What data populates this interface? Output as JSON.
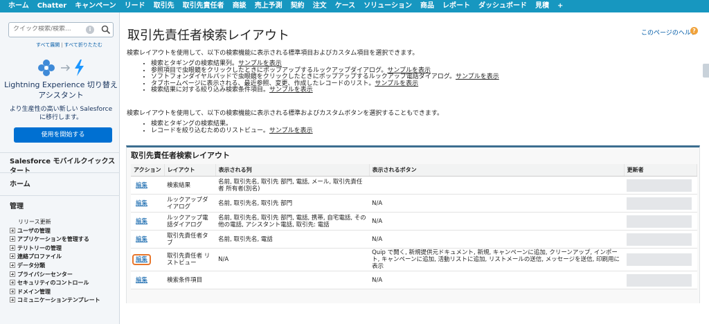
{
  "tabs": [
    "ホーム",
    "Chatter",
    "キャンペーン",
    "リード",
    "取引先",
    "取引先責任者",
    "商談",
    "売上予測",
    "契約",
    "注文",
    "ケース",
    "ソリューション",
    "商品",
    "レポート",
    "ダッシュボード",
    "見積",
    "+"
  ],
  "sidebar": {
    "search_placeholder": "クイック検索/検索...",
    "expand_all": "すべて展開",
    "collapse_all": "すべて折りたたむ",
    "lex_title": "Lightning Experience 切り替えアシスタント",
    "lex_sub": "より生産性の高い新しい Salesforce に移行します。",
    "lex_button": "使用を開始する",
    "mobile_quickstart": "Salesforce モバイルクイックスタート",
    "home": "ホーム",
    "admin": "管理",
    "items": [
      {
        "label": "リリース更新",
        "plus": false
      },
      {
        "label": "ユーザの管理",
        "plus": true
      },
      {
        "label": "アプリケーションを管理する",
        "plus": true
      },
      {
        "label": "テリトリーの管理",
        "plus": true
      },
      {
        "label": "連絡プロファイル",
        "plus": true
      },
      {
        "label": "データ分類",
        "plus": true
      },
      {
        "label": "プライバシーセンター",
        "plus": true
      },
      {
        "label": "セキュリティのコントロール",
        "plus": true
      },
      {
        "label": "ドメイン管理",
        "plus": true
      },
      {
        "label": "コミュニケーションテンプレート",
        "plus": true
      }
    ]
  },
  "main": {
    "title": "取引先責任者検索レイアウト",
    "help_link": "このページのヘルプ",
    "intro1": "検索レイアウトを使用して、以下の検索機能に表示される標準項目およびカスタム項目を選択できます。",
    "bullets1": [
      {
        "text": "検索とタギングの検索結果列。",
        "link": "サンプルを表示"
      },
      {
        "text": "参照項目で虫眼鏡をクリックしたときにポップアップするルックアップダイアログ。",
        "link": "サンプルを表示"
      },
      {
        "text": "ソフトフォンダイヤルパッドで虫眼鏡をクリックしたときにポップアップするルックアップ電話ダイアログ。",
        "link": "サンプルを表示"
      },
      {
        "text": "タブホームページに表示される、最近参照、変更、作成したレコードのリスト。",
        "link": "サンプルを表示"
      },
      {
        "text": "検索結果に対する絞り込み検索条件項目。",
        "link": "サンプルを表示"
      }
    ],
    "intro2": "検索レイアウトを使用して、以下の検索機能に表示される標準およびカスタムボタンを選択することもできます。",
    "bullets2": [
      {
        "text": "検索とタギングの検索結果。",
        "link": ""
      },
      {
        "text": "レコードを絞り込むためのリストビュー。",
        "link": "サンプルを表示"
      }
    ],
    "section_title": "取引先責任者検索レイアウト",
    "columns": [
      "アクション",
      "レイアウト",
      "表示される列",
      "表示されるボタン",
      "更新者"
    ],
    "rows": [
      {
        "action": "編集",
        "layout": "検索結果",
        "columns": "名前, 取引先名, 取引先 部門, 電話, メール, 取引先責任者 所有者(別名)",
        "buttons": ""
      },
      {
        "action": "編集",
        "layout": "ルックアップダイアログ",
        "columns": "名前, 取引先名, 取引先 部門",
        "buttons": "N/A"
      },
      {
        "action": "編集",
        "layout": "ルックアップ電話ダイアログ",
        "columns": "名前, 取引先名, 取引先 部門, 電話, 携帯, 自宅電話, その他の電話, アシスタント電話, 取引先: 電話",
        "buttons": "N/A"
      },
      {
        "action": "編集",
        "layout": "取引先責任者タブ",
        "columns": "名前, 取引先名, 電話",
        "buttons": "N/A"
      },
      {
        "action": "編集",
        "layout": "取引先責任者 リストビュー",
        "columns": "N/A",
        "buttons": "Quip で開く, 新規提供元ドキュメント, 新規, キャンペーンに追加, クリーンアップ, インポート, キャンペーンに追加, 活動リストに追加, リストメールの送信, メッセージを送信, 印刷用に表示"
      },
      {
        "action": "編集",
        "layout": "検索条件項目",
        "columns": "",
        "buttons": "N/A"
      }
    ]
  },
  "colors": {
    "tabbar": "#1797c0",
    "link": "#015ba7",
    "button": "#0070d2",
    "highlight": "#e8762b"
  }
}
